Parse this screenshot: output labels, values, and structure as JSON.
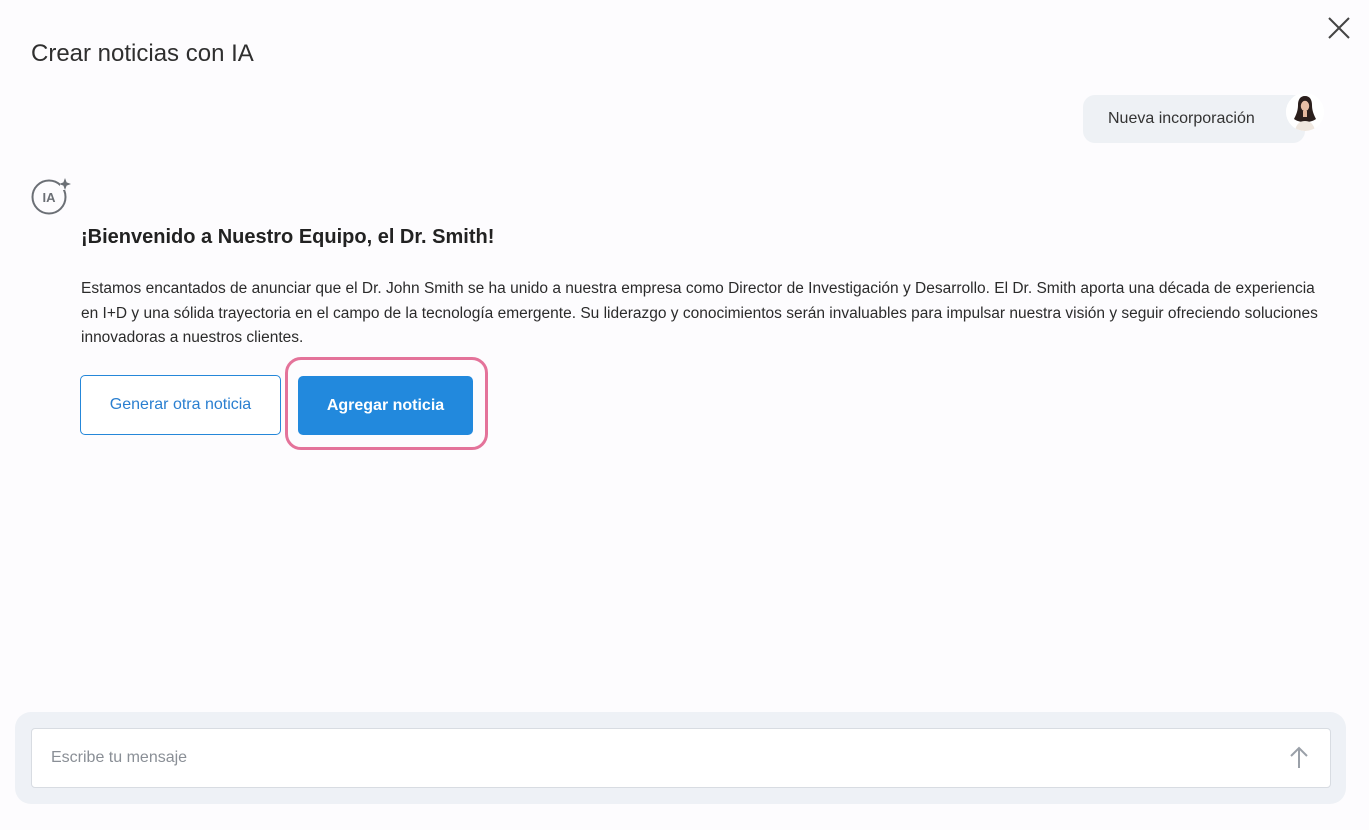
{
  "dialog": {
    "title": "Crear noticias con IA"
  },
  "user_message": {
    "text": "Nueva incorporación"
  },
  "ai_message": {
    "heading": "¡Bienvenido a Nuestro Equipo, el Dr. Smith!",
    "body": "Estamos encantados de anunciar que el Dr. John Smith se ha unido a nuestra empresa como Director de Investigación y Desarrollo. El Dr. Smith aporta una década de experiencia en I+D y una sólida trayectoria en el campo de la tecnología emergente. Su liderazgo y conocimientos serán invaluables para impulsar nuestra visión y seguir ofreciendo soluciones innovadoras a nuestros clientes."
  },
  "actions": {
    "regenerate_label": "Generar otra noticia",
    "add_label": "Agregar noticia"
  },
  "composer": {
    "placeholder": "Escribe tu mensaje"
  },
  "icons": {
    "close": "close-icon",
    "ai": "ai-sparkle-icon",
    "send": "arrow-up-icon",
    "avatar": "user-avatar"
  },
  "colors": {
    "primary": "#2289dd",
    "highlight": "#e4739a",
    "bubble": "#eef1f5"
  }
}
